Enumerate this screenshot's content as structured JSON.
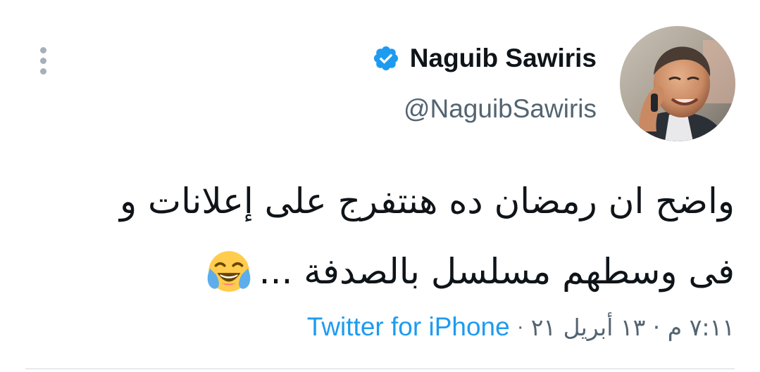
{
  "user": {
    "display_name": "Naguib Sawiris",
    "username": "@NaguibSawiris",
    "verified_icon": "verified-badge-icon",
    "avatar_icon": "profile-photo"
  },
  "tweet": {
    "line1": "واضح ان رمضان ده هنتفرج على إعلانات و",
    "line2": "فى وسطهم مسلسل بالصدفة ...",
    "emoji": "face-with-tears-of-joy-icon",
    "timestamp": "٧:١١ م · ١٣ أبريل ٢١",
    "separator": "·",
    "source": "Twitter for iPhone"
  },
  "menu": {
    "more_icon": "more-vertical-icon"
  },
  "colors": {
    "accent": "#1d9bf0",
    "secondary_text": "#536471",
    "primary_text": "#0f1419",
    "divider": "#cfd9de"
  }
}
